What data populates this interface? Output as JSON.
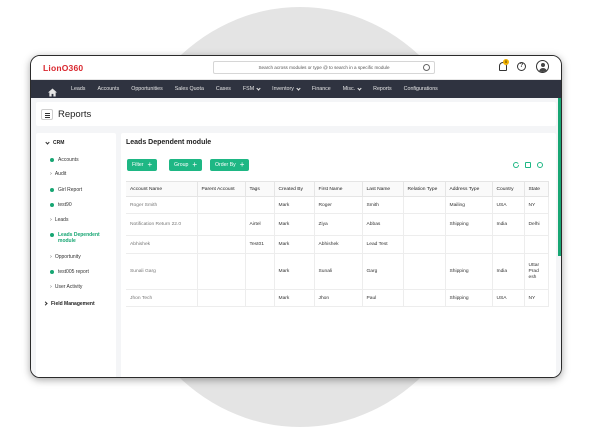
{
  "app": {
    "logo_text": "LionO360",
    "accent": "#1eb784",
    "nav_bg": "#2f3340",
    "brand_red": "#d9272e"
  },
  "header": {
    "search_placeholder": "Search across modules or type @ to search in a specific module",
    "notification_count": "0"
  },
  "nav": {
    "items": [
      {
        "label": "Leads"
      },
      {
        "label": "Accounts"
      },
      {
        "label": "Opportunities"
      },
      {
        "label": "Sales Quota"
      },
      {
        "label": "Cases"
      },
      {
        "label": "FSM"
      },
      {
        "label": "Inventory"
      },
      {
        "label": "Finance"
      },
      {
        "label": "Misc."
      },
      {
        "label": "Reports"
      },
      {
        "label": "Configurations"
      }
    ]
  },
  "page": {
    "title": "Reports"
  },
  "sidebar": {
    "section": "CRM",
    "items": [
      {
        "label": "Accounts",
        "type": "dot"
      },
      {
        "label": "Audit",
        "type": "arrow"
      },
      {
        "label": "Girl Report",
        "type": "dot"
      },
      {
        "label": "test90",
        "type": "dot"
      },
      {
        "label": "Leads",
        "type": "arrow"
      },
      {
        "label": "Leads Dependent",
        "label2": "module",
        "type": "dot",
        "active": true
      },
      {
        "label": "Opportunity",
        "type": "arrow"
      },
      {
        "label": "test005 report",
        "type": "dot"
      },
      {
        "label": "User Activity",
        "type": "arrow"
      },
      {
        "label": "Field Management",
        "type": "partial"
      }
    ]
  },
  "main": {
    "title": "Leads Dependent module",
    "buttons": {
      "filter": "Filter",
      "group": "Group",
      "order_by": "Order By"
    },
    "columns": [
      "Account Name",
      "Parent Account",
      "Tags",
      "Created By",
      "First Name",
      "Last Name",
      "Relation Type",
      "Address Type",
      "Country",
      "State"
    ],
    "rows": [
      [
        "Roger Smith",
        "",
        "",
        "Mark",
        "Roger",
        "Smith",
        "",
        "Mailing",
        "USA",
        "NY"
      ],
      [
        "Notification Return 22.0",
        "",
        "Airtel",
        "Mark",
        "Ziya",
        "Abbas",
        "",
        "Shipping",
        "India",
        "Delhi"
      ],
      [
        "Abhishek",
        "",
        "Test01",
        "Mark",
        "Abhishek",
        "Lead Test",
        "",
        "",
        "",
        ""
      ],
      [
        "Sunali Garg",
        "",
        "",
        "Mark",
        "Sunali",
        "Garg",
        "",
        "Shipping",
        "India",
        "Uttar Prad esh"
      ],
      [
        "Jhon Tech",
        "",
        "",
        "Mark",
        "Jhon",
        "Paul",
        "",
        "Shipping",
        "USA",
        "NY"
      ]
    ]
  }
}
